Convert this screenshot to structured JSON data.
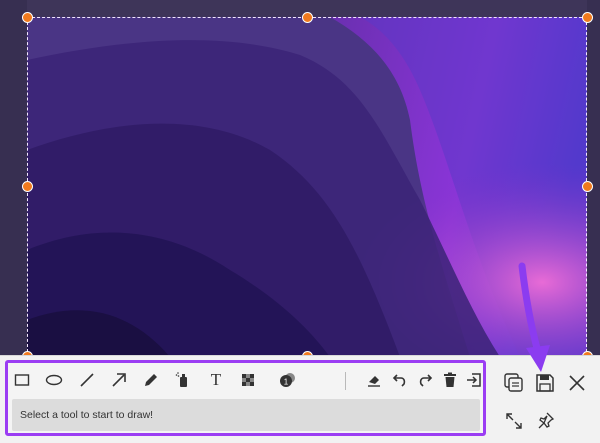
{
  "status": {
    "hint": "Select a tool to start to draw!"
  },
  "toolbar": {
    "tools": [
      {
        "icon": "rectangle-icon"
      },
      {
        "icon": "ellipse-icon"
      },
      {
        "icon": "line-icon"
      },
      {
        "icon": "arrow-icon"
      },
      {
        "icon": "pencil-icon"
      },
      {
        "icon": "spray-icon"
      },
      {
        "icon": "text-icon",
        "glyph": "T"
      },
      {
        "icon": "mosaic-icon"
      },
      {
        "icon": "step-number-icon"
      },
      {
        "icon": "eraser-icon"
      },
      {
        "icon": "undo-icon"
      },
      {
        "icon": "redo-icon"
      },
      {
        "icon": "trash-icon"
      },
      {
        "icon": "exit-icon"
      }
    ],
    "side_actions": [
      {
        "icon": "copy-icon"
      },
      {
        "icon": "save-icon"
      },
      {
        "icon": "close-icon"
      },
      {
        "icon": "fullscreen-icon"
      },
      {
        "icon": "pin-icon"
      }
    ]
  },
  "colors": {
    "highlight_border": "#9b3df3",
    "handle": "#f07a1e",
    "arrow": "#8b3cf0"
  }
}
